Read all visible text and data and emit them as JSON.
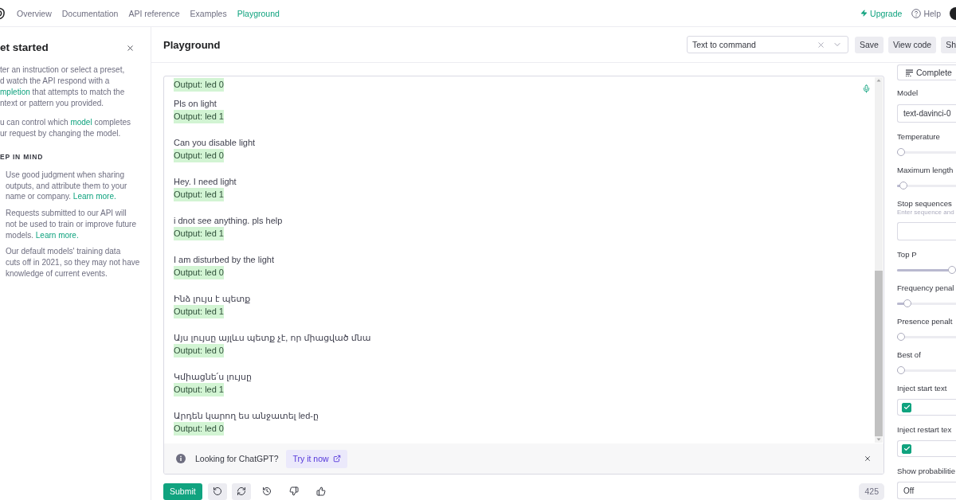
{
  "nav": {
    "items": [
      {
        "label": "Overview",
        "selected": false
      },
      {
        "label": "Documentation",
        "selected": false
      },
      {
        "label": "API reference",
        "selected": false
      },
      {
        "label": "Examples",
        "selected": false
      },
      {
        "label": "Playground",
        "selected": true
      }
    ],
    "upgrade": "Upgrade",
    "help": "Help"
  },
  "sidebar": {
    "title": "et started",
    "paragraphs": [
      [
        {
          "text": "ter an instruction or select a preset,\nd watch the API respond with a\n"
        },
        {
          "link": "mpletion"
        },
        {
          "text": " that attempts to match the\nntext or pattern you provided."
        }
      ],
      [
        {
          "text": "u can control which "
        },
        {
          "link": "model"
        },
        {
          "text": " completes\nur request by changing the model."
        }
      ]
    ],
    "section_title": "EP IN MIND",
    "notes": [
      {
        "text": "Use good judgment when sharing\noutputs, and attribute them to your\nname or company.",
        "link": "Learn more."
      },
      {
        "text": "Requests submitted to our API will\nnot be used to train or improve future\nmodels.",
        "link": "Learn more."
      },
      {
        "text": "Our default models' training data\ncuts off in 2021, so they may not have\nknowledge of current events."
      }
    ]
  },
  "header": {
    "title": "Playground",
    "preset": "Text to command",
    "buttons": [
      "Save",
      "View code",
      "Sh"
    ]
  },
  "editor": {
    "entries": [
      {
        "output": "Output: led 0",
        "highlighted": true
      },
      {
        "prompt": "Pls on light",
        "output": "Output: led 1",
        "highlighted": true
      },
      {
        "prompt": "Can you disable light",
        "output": "Output: led 0",
        "highlighted": true
      },
      {
        "prompt": "Hey. I need light",
        "output": "Output: led 1",
        "highlighted": true
      },
      {
        "prompt": "i dnot see anything. pls help",
        "output": "Output: led 1",
        "highlighted": true
      },
      {
        "prompt": "I am disturbed by the light",
        "output": "Output: led 0",
        "highlighted": true
      },
      {
        "prompt": "Ինձ լույս է պետք",
        "output": "Output: led 1",
        "highlighted": true
      },
      {
        "prompt": "Այս լույսը այլևս պետք չէ, որ միացված մնա",
        "output": "Output: led 0",
        "highlighted": true
      },
      {
        "prompt": "Կմիացնե՛ս լույսը",
        "output": "Output: led 1",
        "highlighted": true
      },
      {
        "prompt": "Արդեն կարող ես անջատել led-ը",
        "output": "Output: led 0",
        "highlighted": true
      }
    ],
    "banner": {
      "text": "Looking for ChatGPT?",
      "link": "Try it now"
    }
  },
  "toolbar": {
    "submit": "Submit",
    "icon_buttons": [
      {
        "kind": "shaded"
      },
      {
        "kind": "shaded"
      },
      {
        "kind": "plain"
      },
      {
        "kind": "plain"
      },
      {
        "kind": "plain"
      }
    ],
    "token_count": "425"
  },
  "settings": {
    "mode": "Complete",
    "fields": [
      {
        "kind": "select",
        "label": "Model",
        "value": "text-davinci-0"
      },
      {
        "kind": "slider",
        "label": "Temperature",
        "level": 0
      },
      {
        "kind": "slider",
        "label": "Maximum length",
        "level": 0.04
      },
      {
        "kind": "text_input",
        "label": "Stop sequences",
        "hint": "Enter sequence and"
      },
      {
        "kind": "slider",
        "label": "Top P",
        "level": 1
      },
      {
        "kind": "slider",
        "label": "Frequency penal",
        "level": 0.12
      },
      {
        "kind": "slider",
        "label": "Presence penalt",
        "level": 0
      },
      {
        "kind": "slider",
        "label": "Best of",
        "level": 0
      },
      {
        "kind": "checkbox",
        "label": "Inject start text",
        "checked": true
      },
      {
        "kind": "checkbox",
        "label": "Inject restart tex",
        "checked": true
      },
      {
        "kind": "select",
        "label": "Show probabilitie",
        "value": "Off"
      }
    ]
  }
}
